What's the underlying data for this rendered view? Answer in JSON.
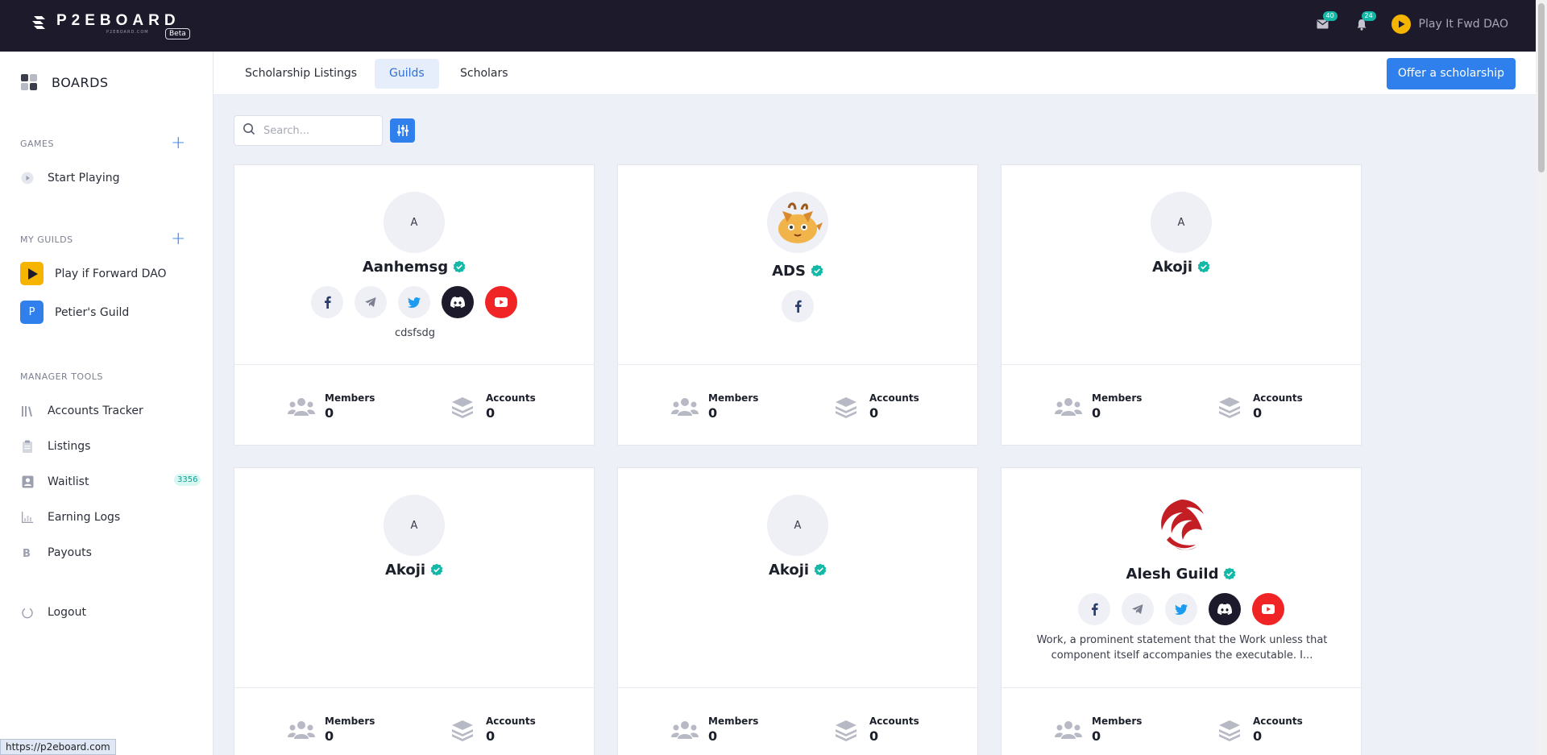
{
  "header": {
    "logo_text": "P2EBOARD",
    "logo_sub": "P2EBOARD.COM",
    "beta": "Beta",
    "mail_count": "40",
    "notif_count": "24",
    "user_name": "Play It Fwd DAO"
  },
  "sidebar": {
    "boards": "BOARDS",
    "games_title": "GAMES",
    "start_playing": "Start Playing",
    "my_guilds_title": "MY GUILDS",
    "guilds": [
      {
        "label": "Play if Forward DAO",
        "initial": ""
      },
      {
        "label": "Petier's Guild",
        "initial": "P"
      }
    ],
    "manager_title": "MANAGER TOOLS",
    "tools": [
      {
        "label": "Accounts Tracker"
      },
      {
        "label": "Listings"
      },
      {
        "label": "Waitlist",
        "badge": "3356"
      },
      {
        "label": "Earning Logs"
      },
      {
        "label": "Payouts"
      }
    ],
    "logout": "Logout"
  },
  "tabs": [
    {
      "label": "Scholarship Listings",
      "active": false
    },
    {
      "label": "Guilds",
      "active": true
    },
    {
      "label": "Scholars",
      "active": false
    }
  ],
  "offer_button": "Offer a scholarship",
  "search": {
    "placeholder": "Search..."
  },
  "stat_labels": {
    "members": "Members",
    "accounts": "Accounts"
  },
  "cards": [
    {
      "name": "Aanhemsg",
      "avatar": "A",
      "description": "cdsfsdg",
      "members": "0",
      "accounts": "0"
    },
    {
      "name": "ADS",
      "avatar": "",
      "description": "",
      "members": "0",
      "accounts": "0"
    },
    {
      "name": "Akoji",
      "avatar": "A",
      "description": "",
      "members": "0",
      "accounts": "0"
    },
    {
      "name": "Akoji",
      "avatar": "A",
      "description": "",
      "members": "0",
      "accounts": "0"
    },
    {
      "name": "Akoji",
      "avatar": "A",
      "description": "",
      "members": "0",
      "accounts": "0"
    },
    {
      "name": "Alesh Guild",
      "avatar": "",
      "description": "Work, a prominent statement that the Work unless that component itself accompanies the executable. I...",
      "members": "0",
      "accounts": "0"
    }
  ],
  "status_url": "https://p2eboard.com",
  "colors": {
    "accent": "#2f80ed",
    "topbar": "#1d1b2b",
    "verified": "#14b8a6",
    "youtube": "#f02424"
  }
}
